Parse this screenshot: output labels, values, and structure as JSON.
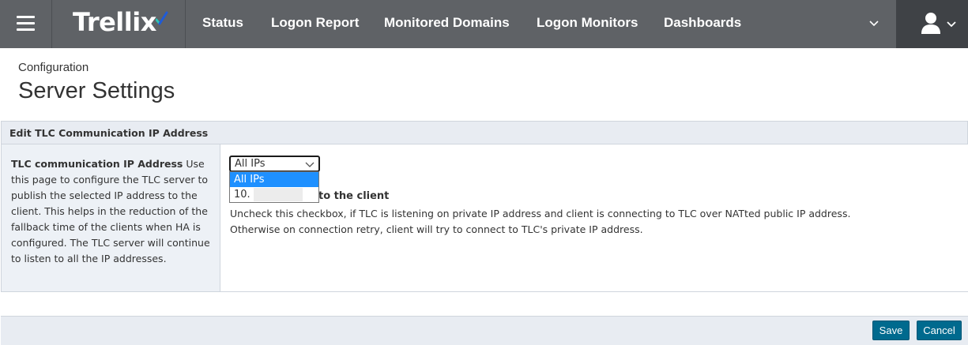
{
  "app": {
    "logo_text": "Trellix"
  },
  "nav": {
    "items": [
      {
        "label": "Status"
      },
      {
        "label": "Logon Report"
      },
      {
        "label": "Monitored Domains"
      },
      {
        "label": "Logon Monitors"
      },
      {
        "label": "Dashboards"
      }
    ]
  },
  "header": {
    "breadcrumb": "Configuration",
    "title": "Server Settings"
  },
  "panel": {
    "title": "Edit TLC Communication IP Address",
    "help_title": "TLC communication IP Address",
    "help_text": " Use this page to configure the TLC server to publish the selected IP address to the client. This helps in the reduction of the fallback time of the clients when HA is configured. The TLC server will continue to listen to all the IP addresses."
  },
  "ip_select": {
    "value": "All IPs",
    "options": [
      "All IPs",
      "10."
    ]
  },
  "checkbox": {
    "label_visible": "to the client",
    "desc_line1": "Uncheck this checkbox, if TLC is listening on private IP address and client is connecting to TLC over NATted public IP address.",
    "desc_line2": "Otherwise on connection retry, client will try to connect to TLC's private IP address."
  },
  "footer": {
    "save_label": "Save",
    "cancel_label": "Cancel"
  },
  "colors": {
    "topbar": "#5f6266",
    "accent_button": "#006a8e",
    "selected_option": "#1e90ff",
    "logo_check_teal": "#2dc3b8",
    "logo_check_blue": "#1f5bd8"
  }
}
